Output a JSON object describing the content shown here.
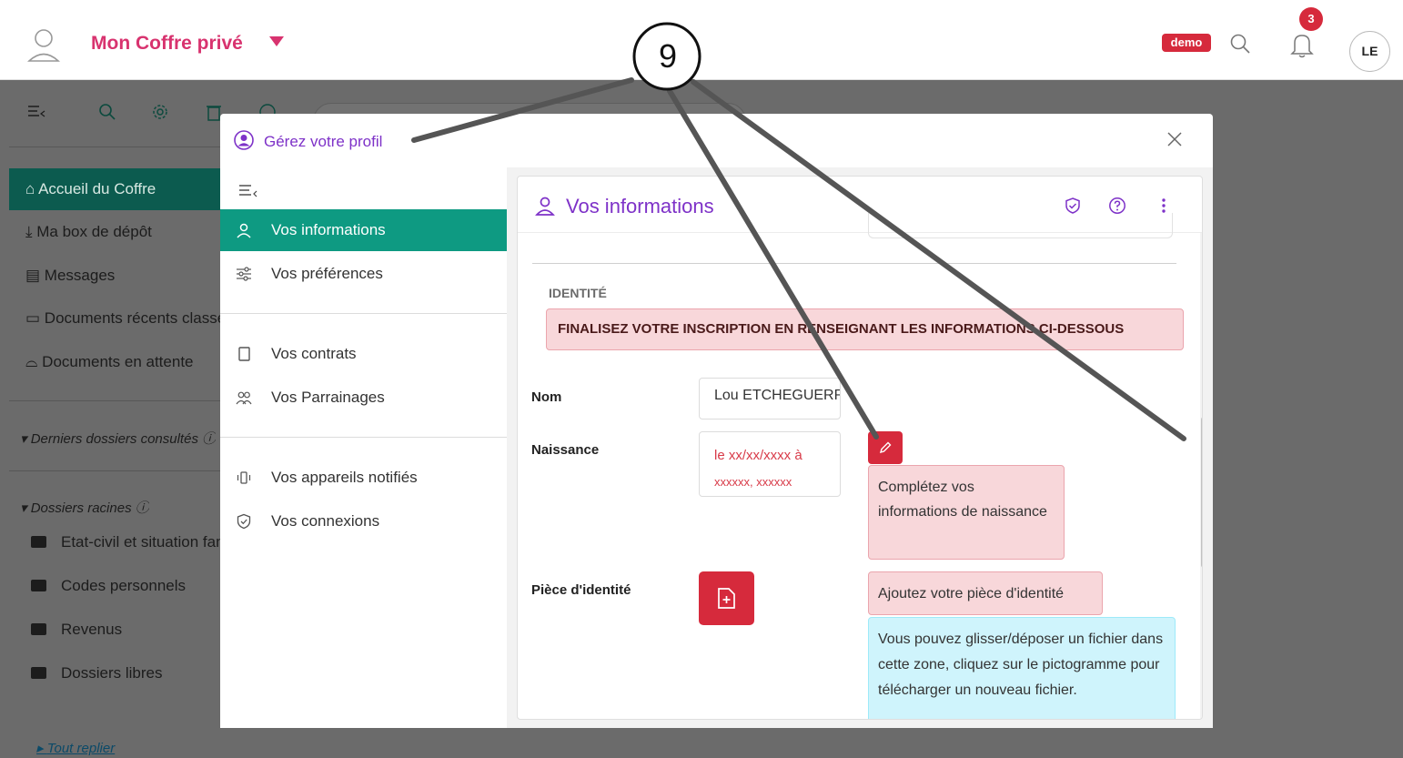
{
  "header": {
    "vault_title": "Mon Coffre privé",
    "demo_badge": "demo",
    "notifications_count": "3",
    "avatar_initials": "LE"
  },
  "sidebar": {
    "items": [
      {
        "label": "Accueil du Coffre",
        "active": true
      },
      {
        "label": "Ma box de dépôt"
      },
      {
        "label": "Messages"
      },
      {
        "label": "Documents récents classés"
      },
      {
        "label": "Documents en attente"
      }
    ],
    "recent_section": "Derniers dossiers consultés",
    "root_section": "Dossiers racines",
    "folders": [
      "Etat-civil et situation familiale",
      "Codes personnels",
      "Revenus",
      "Dossiers libres"
    ],
    "collapse_link": "Tout replier"
  },
  "modal": {
    "title": "Gérez votre profil",
    "nav": [
      {
        "label": "Vos informations",
        "icon": "person-icon",
        "active": true
      },
      {
        "label": "Vos préférences",
        "icon": "sliders-icon"
      },
      {
        "label": "Vos contrats",
        "icon": "copy-icon"
      },
      {
        "label": "Vos Parrainages",
        "icon": "people-icon"
      },
      {
        "label": "Vos appareils notifiés",
        "icon": "phone-vibrate-icon"
      },
      {
        "label": "Vos connexions",
        "icon": "shield-icon"
      }
    ],
    "card": {
      "title": "Vos informations",
      "section_label": "IDENTITÉ",
      "alert": "FINALISEZ VOTRE INSCRIPTION EN RENSEIGNANT LES INFORMATIONS CI-DESSOUS",
      "fields": {
        "name_label": "Nom",
        "name_value": "Lou ETCHEGUERRY",
        "birth_label": "Naissance",
        "birth_value_line1": "le xx/xx/xxxx à",
        "birth_value_line2": "xxxxxx, xxxxxx",
        "birth_hint": "Complétez vos informations de naissance",
        "id_label": "Pièce d'identité",
        "id_hint": "Ajoutez votre pièce d'identité",
        "upload_info": "Vous pouvez glisser/déposer un fichier dans cette zone, cliquez sur le pictogramme pour télécharger un nouveau fichier."
      }
    }
  },
  "annotation": {
    "number": "9",
    "line_color": "#555555"
  },
  "colors": {
    "brand_pink": "#d8336f",
    "purple": "#7e32c8",
    "teal_active": "#0e9a82",
    "danger": "#d62a3c"
  }
}
